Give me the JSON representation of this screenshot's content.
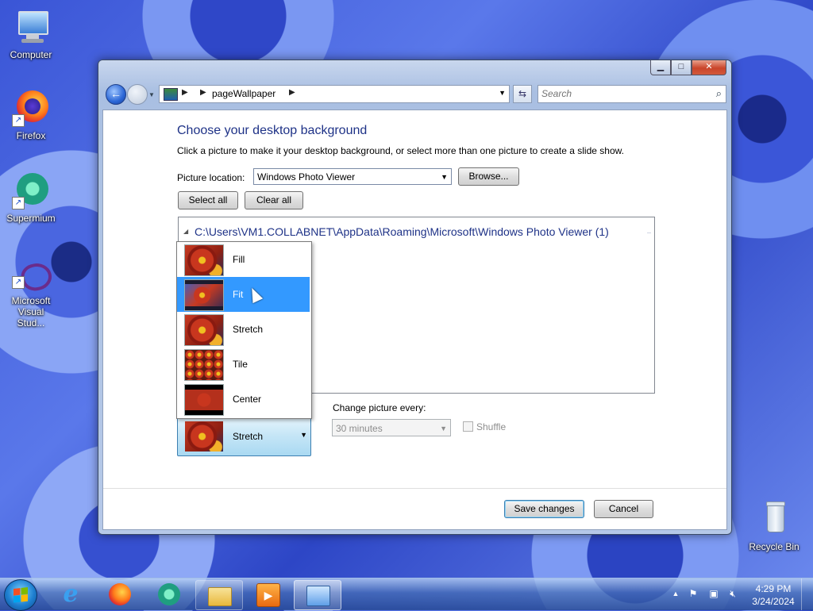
{
  "desktop": {
    "icons": [
      {
        "label": "Computer"
      },
      {
        "label": "Firefox"
      },
      {
        "label": "Supermium"
      },
      {
        "label": "Microsoft Visual Stud..."
      },
      {
        "label": "Recycle Bin"
      }
    ]
  },
  "window": {
    "controls": {
      "minimize": "▁",
      "maximize": "□",
      "close": "✕"
    },
    "address": {
      "crumb": "pageWallpaper"
    },
    "search": {
      "placeholder": "Search"
    },
    "title": "Choose your desktop background",
    "description": "Click a picture to make it your desktop background, or select more than one picture to create a slide show.",
    "picture_location": {
      "label": "Picture location:",
      "value": "Windows Photo Viewer",
      "browse_label": "Browse..."
    },
    "select_all_label": "Select all",
    "clear_all_label": "Clear all",
    "group_header": "C:\\Users\\VM1.COLLABNET\\AppData\\Roaming\\Microsoft\\Windows Photo Viewer (1)",
    "position": {
      "selected": "Stretch",
      "options": [
        {
          "label": "Fill"
        },
        {
          "label": "Fit"
        },
        {
          "label": "Stretch"
        },
        {
          "label": "Tile"
        },
        {
          "label": "Center"
        }
      ],
      "highlighted": "Fit"
    },
    "change_picture": {
      "label": "Change picture every:",
      "value": "30 minutes",
      "shuffle_label": "Shuffle"
    },
    "save_label": "Save changes",
    "cancel_label": "Cancel"
  },
  "taskbar": {
    "clock": {
      "time": "4:29 PM",
      "date": "3/24/2024"
    }
  },
  "colors": {
    "heading_blue": "#1e3287",
    "selection_blue": "#3399ff"
  }
}
